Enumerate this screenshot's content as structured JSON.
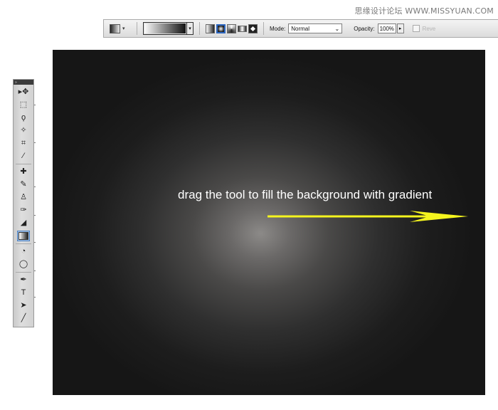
{
  "watermark": "思缘设计论坛 WWW.MISSYUAN.COM",
  "options_bar": {
    "mode_label": "Mode:",
    "mode_value": "Normal",
    "opacity_label": "Opacity:",
    "opacity_value": "100%",
    "reverse_label": "Reve",
    "gradient_types": [
      "linear",
      "radial",
      "angle",
      "reflected",
      "diamond"
    ],
    "selected_gradient_type": "radial"
  },
  "tools_panel": {
    "header": "»",
    "tools": [
      {
        "name": "move-tool",
        "icon": "move-icon",
        "glyph": "▸✥"
      },
      {
        "name": "marquee-tool",
        "icon": "marquee-icon",
        "glyph": "⬚"
      },
      {
        "name": "lasso-tool",
        "icon": "lasso-icon",
        "glyph": "ϙ"
      },
      {
        "name": "quick-selection-tool",
        "icon": "quick-selection-icon",
        "glyph": "✧"
      },
      {
        "name": "crop-tool",
        "icon": "crop-icon",
        "glyph": "⌗"
      },
      {
        "name": "eyedropper-tool",
        "icon": "eyedropper-icon",
        "glyph": "⁄"
      },
      {
        "name": "healing-brush-tool",
        "icon": "bandage-icon",
        "glyph": "✚"
      },
      {
        "name": "brush-tool",
        "icon": "brush-icon",
        "glyph": "✎"
      },
      {
        "name": "clone-stamp-tool",
        "icon": "stamp-icon",
        "glyph": "♙"
      },
      {
        "name": "history-brush-tool",
        "icon": "history-brush-icon",
        "glyph": "✑"
      },
      {
        "name": "eraser-tool",
        "icon": "eraser-icon",
        "glyph": "◢"
      },
      {
        "name": "gradient-tool",
        "icon": "gradient-icon",
        "glyph": ""
      },
      {
        "name": "blur-tool",
        "icon": "blur-icon",
        "glyph": "◔"
      },
      {
        "name": "dodge-tool",
        "icon": "dodge-icon",
        "glyph": "◯"
      },
      {
        "name": "pen-tool",
        "icon": "pen-icon",
        "glyph": "✒"
      },
      {
        "name": "type-tool",
        "icon": "type-icon",
        "glyph": "T"
      },
      {
        "name": "path-selection-tool",
        "icon": "path-selection-icon",
        "glyph": "➤"
      },
      {
        "name": "shape-tool",
        "icon": "line-icon",
        "glyph": "╱"
      }
    ],
    "active_tool": "gradient-tool"
  },
  "canvas": {
    "caption": "drag the tool to fill the background with gradient",
    "arrow_color": "#f5f51e"
  },
  "colors": {
    "canvas_dark": "#161616",
    "canvas_light": "#8c8a88",
    "selected_tool_bg": "#a9c6e8"
  }
}
